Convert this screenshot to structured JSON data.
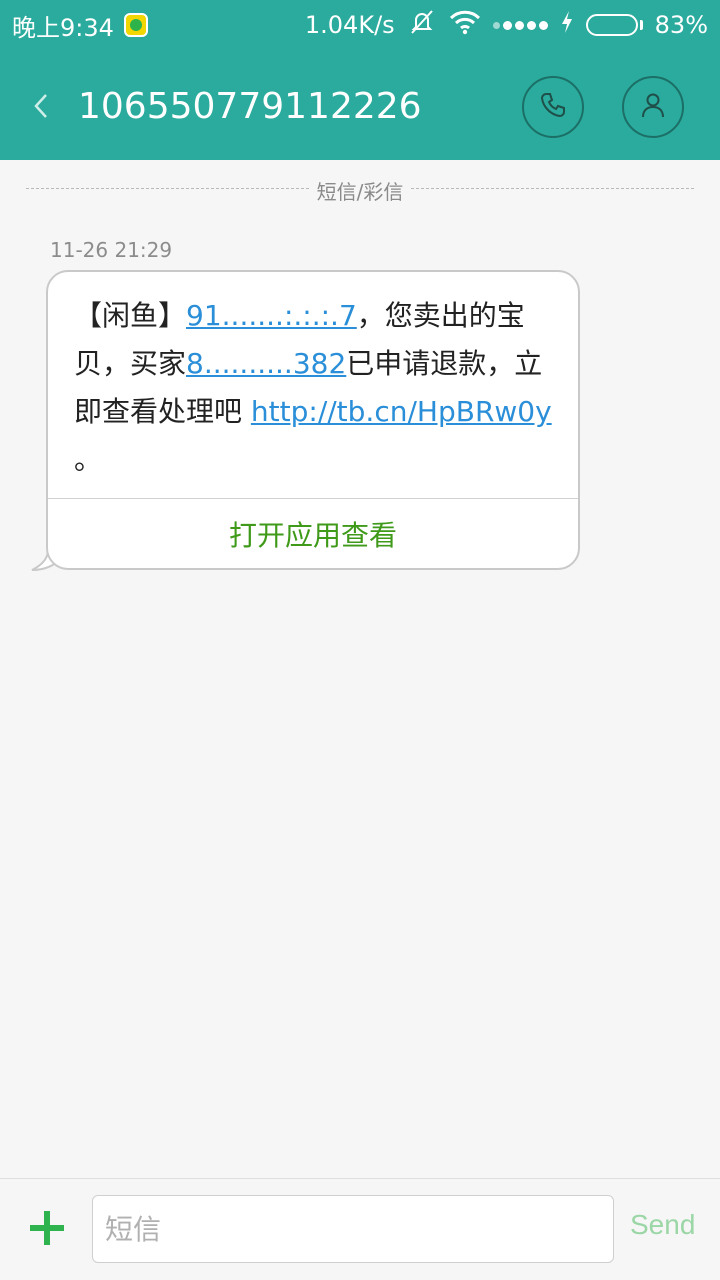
{
  "status_bar": {
    "time": "晚上9:34",
    "net_speed": "1.04K/s",
    "battery_percent": "83%",
    "battery_level": 0.83
  },
  "header": {
    "title": "106550779112226"
  },
  "conversation": {
    "type_label": "短信/彩信",
    "messages": [
      {
        "time": "11-26 21:29",
        "text_prefix": "【闲鱼】",
        "link_order": "91.......:.:.:.7",
        "text_part2": "，您卖出的宝贝，买家",
        "link_buyer": "8..........382",
        "text_part3": "已申请退款，立即查看处理吧 ",
        "link_url": "http://tb.cn/HpBRw0y",
        "text_end": " 。",
        "action_label": "打开应用查看"
      }
    ]
  },
  "composer": {
    "placeholder": "短信",
    "send_label": "Send"
  }
}
